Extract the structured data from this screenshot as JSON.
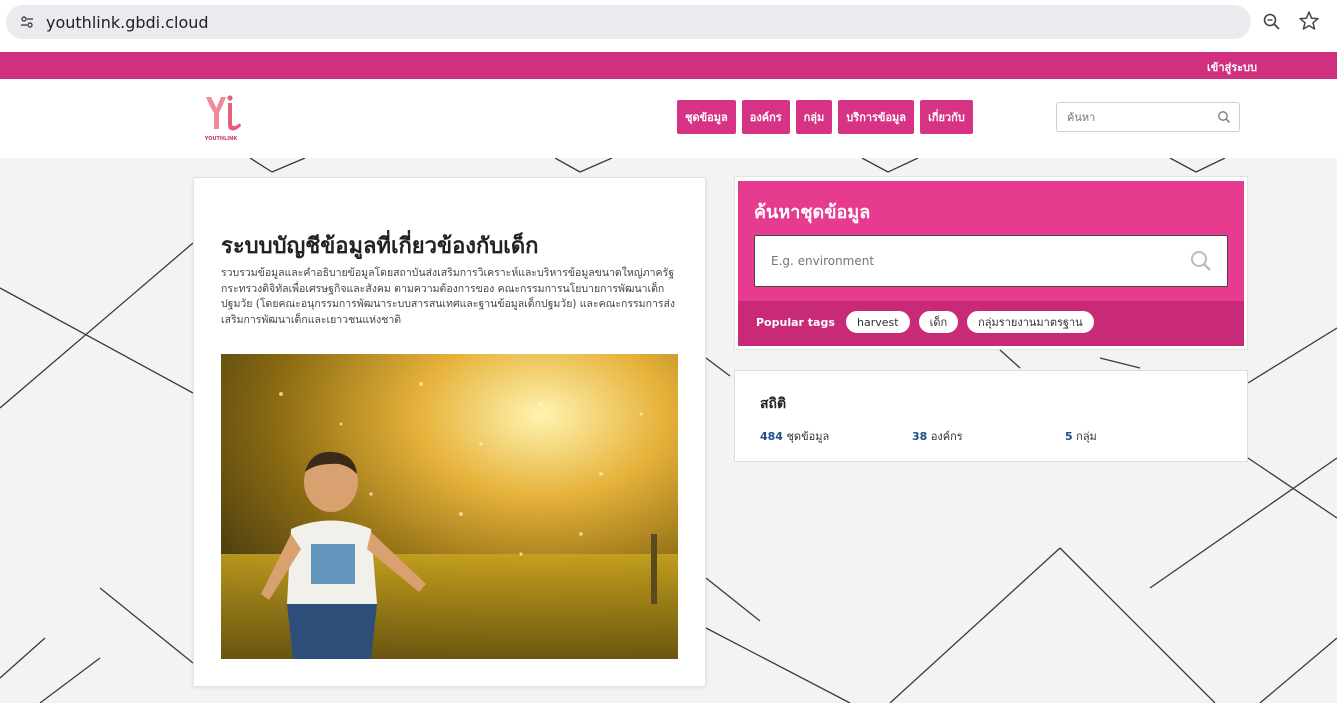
{
  "browser": {
    "url": "youthlink.gbdi.cloud",
    "icons": [
      "site-info-icon",
      "zoom-icon",
      "star-icon"
    ]
  },
  "top_strip": {
    "login_label": "เข้าสู่ระบบ"
  },
  "header": {
    "logo_text": "YOUTHLINK",
    "nav_items": [
      "ชุดข้อมูล",
      "องค์กร",
      "กลุ่ม",
      "บริการข้อมูล",
      "เกี่ยวกับ"
    ],
    "search_placeholder": "ค้นหา"
  },
  "intro": {
    "title": "ระบบบัญชีข้อมูลที่เกี่ยวข้องกับเด็ก",
    "description": "รวบรวมข้อมูลและคำอธิบายข้อมูลโดยสถาบันส่งเสริมการวิเคราะห์และบริหารข้อมูลขนาดใหญ่ภาครัฐ กระทรวงดิจิทัลเพื่อเศรษฐกิจและสังคม ตามความต้องการของ คณะกรรมการนโยบายการพัฒนาเด็กปฐมวัย (โดยคณะอนุกรรมการพัฒนาระบบสารสนเทศและฐานข้อมูลเด็กปฐมวัย) และคณะกรรมการส่งเสริมการพัฒนาเด็กและเยาวชนแห่งชาติ"
  },
  "search_panel": {
    "title": "ค้นหาชุดข้อมูล",
    "placeholder": "E.g. environment",
    "tags_label": "Popular tags",
    "tags": [
      "harvest",
      "เด็ก",
      "กลุ่มรายงานมาตรฐาน"
    ]
  },
  "stats": {
    "title": "สถิติ",
    "datasets_count": "484",
    "datasets_label": "ชุดข้อมูล",
    "orgs_count": "38",
    "orgs_label": "องค์กร",
    "groups_count": "5",
    "groups_label": "กลุ่ม"
  },
  "colors": {
    "brand_pink": "#d63384",
    "strip_pink": "#d0307e",
    "panel_pink": "#e63b8f",
    "panel_pink_dark": "#c92a78",
    "stat_link": "#1b4f8a"
  }
}
